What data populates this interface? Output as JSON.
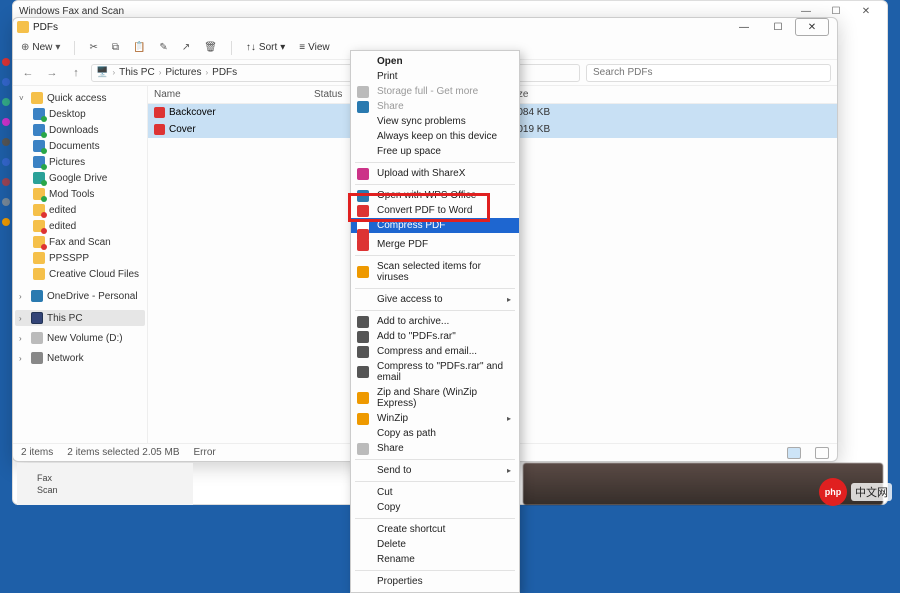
{
  "bg_window": {
    "title": "Windows Fax and Scan"
  },
  "window": {
    "title": "PDFs",
    "controls": {
      "min": "—",
      "max": "☐",
      "close": "✕"
    }
  },
  "toolbar": {
    "new": "New",
    "sort": "Sort",
    "view": "View"
  },
  "breadcrumb": [
    "This PC",
    "Pictures",
    "PDFs"
  ],
  "search": {
    "placeholder": "Search PDFs"
  },
  "columns": {
    "name": "Name",
    "status": "Status",
    "size": "Size"
  },
  "rows": [
    {
      "name": "Backcover",
      "size": "1,084 KB"
    },
    {
      "name": "Cover",
      "size": "1,019 KB"
    }
  ],
  "nav": {
    "quick_access": "Quick access",
    "items_pinned": [
      "Desktop",
      "Downloads",
      "Documents",
      "Pictures",
      "Google Drive",
      "Mod Tools"
    ],
    "items_recent": [
      "edited",
      "Fax and Scan",
      "PPSSPP",
      "Creative Cloud Files",
      "edited"
    ],
    "onedrive": "OneDrive - Personal",
    "this_pc": "This PC",
    "new_volume": "New Volume (D:)",
    "network": "Network"
  },
  "context_menu": {
    "open": "Open",
    "print": "Print",
    "storage_full": "Storage full - Get more",
    "share_g": "Share",
    "view_sync": "View sync problems",
    "always_keep": "Always keep on this device",
    "free_up": "Free up space",
    "sharex": "Upload with ShareX",
    "wps": "Open with WPS Office",
    "conv_word": "Convert PDF to Word",
    "compress_pdf": "Compress PDF",
    "hidden_row": "",
    "merge_pdf": "Merge PDF",
    "scan_virus": "Scan selected items for viruses",
    "give_access": "Give access to",
    "add_archive": "Add to archive...",
    "add_rar": "Add to \"PDFs.rar\"",
    "comp_email": "Compress and email...",
    "comp_rar_email": "Compress to \"PDFs.rar\" and email",
    "zip_share": "Zip and Share (WinZip Express)",
    "winzip": "WinZip",
    "copy_path": "Copy as path",
    "share": "Share",
    "send_to": "Send to",
    "cut": "Cut",
    "copy": "Copy",
    "create_shortcut": "Create shortcut",
    "delete": "Delete",
    "rename": "Rename",
    "properties": "Properties"
  },
  "statusbar": {
    "count": "2 items",
    "selected": "2 items selected  2.05 MB",
    "error": "Error"
  },
  "left_blur": {
    "l1": "Fax",
    "l2": "Scan"
  },
  "watermark": {
    "txt": "中文网",
    "logo": "php"
  }
}
